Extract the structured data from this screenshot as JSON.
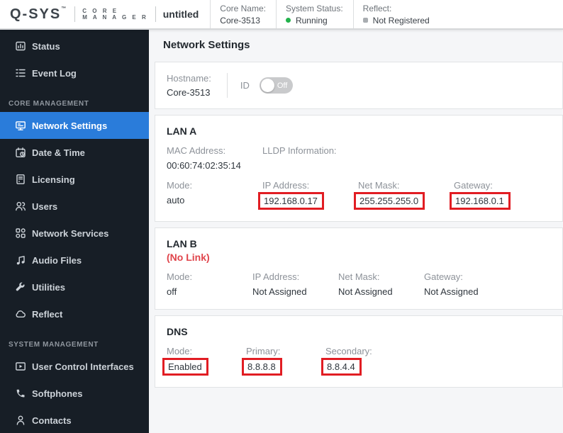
{
  "colors": {
    "accent_blue": "#2a7cda",
    "sidebar_bg": "#171e26",
    "running_green": "#22b24c",
    "reflect_gray": "#a9adb1",
    "annotation_red": "#e11d23",
    "no_link_red": "#e0444b"
  },
  "header": {
    "logo_primary": "Q-SYS",
    "logo_tm": "™",
    "logo_secondary_line1": "C O R E",
    "logo_secondary_line2": "M A N A G E R",
    "design_name": "untitled",
    "core_name_label": "Core Name:",
    "core_name_value": "Core-3513",
    "system_status_label": "System Status:",
    "system_status_value": "Running",
    "reflect_label": "Reflect:",
    "reflect_value": "Not Registered"
  },
  "sidebar": {
    "section_core_label": "CORE MANAGEMENT",
    "section_system_label": "SYSTEM MANAGEMENT",
    "items": [
      {
        "label": "Status",
        "icon": "status-icon"
      },
      {
        "label": "Event Log",
        "icon": "event-log-icon"
      },
      {
        "label": "Network Settings",
        "icon": "network-settings-icon",
        "active": true
      },
      {
        "label": "Date & Time",
        "icon": "date-time-icon"
      },
      {
        "label": "Licensing",
        "icon": "licensing-icon"
      },
      {
        "label": "Users",
        "icon": "users-icon"
      },
      {
        "label": "Network Services",
        "icon": "network-services-icon"
      },
      {
        "label": "Audio Files",
        "icon": "audio-files-icon"
      },
      {
        "label": "Utilities",
        "icon": "utilities-icon"
      },
      {
        "label": "Reflect",
        "icon": "reflect-icon"
      },
      {
        "label": "User Control Interfaces",
        "icon": "user-control-interfaces-icon"
      },
      {
        "label": "Softphones",
        "icon": "softphones-icon"
      },
      {
        "label": "Contacts",
        "icon": "contacts-icon"
      }
    ]
  },
  "main": {
    "title": "Network Settings",
    "hostname_card": {
      "hostname_label": "Hostname:",
      "hostname_value": "Core-3513",
      "id_label": "ID",
      "id_toggle_state": "Off"
    },
    "lan_a": {
      "title": "LAN A",
      "mac_label": "MAC Address:",
      "mac_value": "00:60:74:02:35:14",
      "lldp_label": "LLDP Information:",
      "mode_label": "Mode:",
      "mode_value": "auto",
      "ip_label": "IP Address:",
      "ip_value": "192.168.0.17",
      "netmask_label": "Net Mask:",
      "netmask_value": "255.255.255.0",
      "gateway_label": "Gateway:",
      "gateway_value": "192.168.0.1"
    },
    "lan_b": {
      "title": "LAN B",
      "status": "(No Link)",
      "mode_label": "Mode:",
      "mode_value": "off",
      "ip_label": "IP Address:",
      "ip_value": "Not Assigned",
      "netmask_label": "Net Mask:",
      "netmask_value": "Not Assigned",
      "gateway_label": "Gateway:",
      "gateway_value": "Not Assigned"
    },
    "dns": {
      "title": "DNS",
      "mode_label": "Mode:",
      "mode_value": "Enabled",
      "primary_label": "Primary:",
      "primary_value": "8.8.8.8",
      "secondary_label": "Secondary:",
      "secondary_value": "8.8.4.4"
    },
    "annotations": {
      "boxed_values": [
        "192.168.0.17",
        "255.255.255.0",
        "192.168.0.1",
        "Enabled",
        "8.8.8.8",
        "8.8.4.4"
      ]
    }
  }
}
